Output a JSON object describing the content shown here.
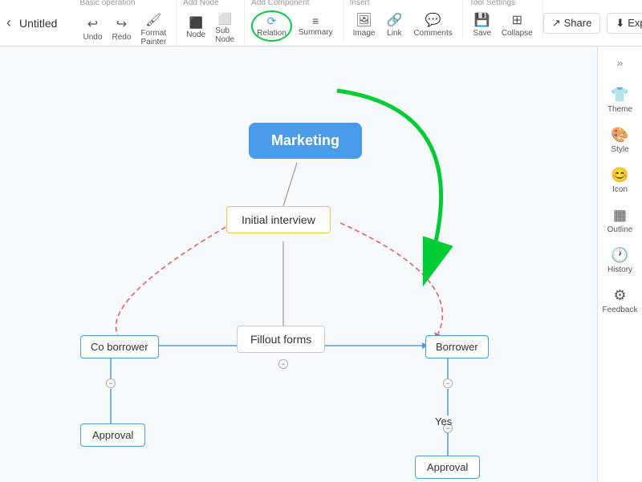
{
  "app": {
    "title": "Untitled"
  },
  "toolbar": {
    "back_label": "‹",
    "groups": [
      {
        "label": "Basic operation",
        "items": [
          {
            "id": "undo",
            "icon": "↩",
            "label": "Undo"
          },
          {
            "id": "redo",
            "icon": "↪",
            "label": "Redo"
          },
          {
            "id": "format-painter",
            "icon": "🖌",
            "label": "Format Painter"
          }
        ]
      },
      {
        "label": "Add Node",
        "items": [
          {
            "id": "node",
            "icon": "⬜",
            "label": "Node"
          },
          {
            "id": "sub-node",
            "icon": "⬜",
            "label": "Sub Node"
          }
        ]
      },
      {
        "label": "Add Component",
        "items": [
          {
            "id": "relation",
            "icon": "⟳",
            "label": "Relation",
            "highlighted": true
          },
          {
            "id": "summary",
            "icon": "≡",
            "label": "Summary"
          }
        ]
      },
      {
        "label": "Insert",
        "items": [
          {
            "id": "image",
            "icon": "🖼",
            "label": "Image"
          },
          {
            "id": "link",
            "icon": "🔗",
            "label": "Link"
          },
          {
            "id": "comments",
            "icon": "💬",
            "label": "Comments"
          }
        ]
      },
      {
        "label": "Tool Settings",
        "items": [
          {
            "id": "save",
            "icon": "💾",
            "label": "Save"
          },
          {
            "id": "collapse",
            "icon": "⊞",
            "label": "Collapse"
          }
        ]
      }
    ],
    "share_label": "Share",
    "export_label": "Export"
  },
  "canvas": {
    "nodes": {
      "marketing": {
        "label": "Marketing"
      },
      "initial_interview": {
        "label": "Initial interview"
      },
      "fillout_forms": {
        "label": "Fillout forms"
      },
      "co_borrower": {
        "label": "Co borrower"
      },
      "borrower": {
        "label": "Borrower"
      },
      "approval_left": {
        "label": "Approval"
      },
      "yes": {
        "label": "Yes"
      },
      "approval_right": {
        "label": "Approval"
      }
    }
  },
  "sidebar": {
    "collapse_icon": "»",
    "items": [
      {
        "id": "theme",
        "icon": "👕",
        "label": "Theme"
      },
      {
        "id": "style",
        "icon": "🎨",
        "label": "Style"
      },
      {
        "id": "icon",
        "icon": "😊",
        "label": "Icon"
      },
      {
        "id": "outline",
        "icon": "▦",
        "label": "Outline"
      },
      {
        "id": "history",
        "icon": "🕐",
        "label": "History"
      },
      {
        "id": "feedback",
        "icon": "⚙",
        "label": "Feedback"
      }
    ]
  }
}
